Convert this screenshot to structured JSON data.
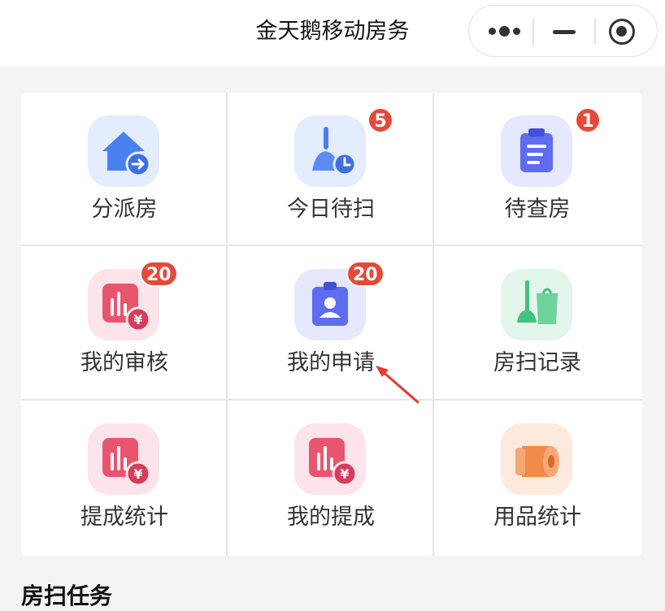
{
  "navbar": {
    "title": "金天鹅移动房务",
    "more_icon": "more-dots-icon",
    "minimize_icon": "minimize-icon",
    "close_icon": "target-close-icon"
  },
  "menu": [
    {
      "label": "分派房",
      "icon": "house-assign-icon",
      "badge": ""
    },
    {
      "label": "今日待扫",
      "icon": "broom-clock-icon",
      "badge": "5"
    },
    {
      "label": "待查房",
      "icon": "clipboard-icon",
      "badge": "1"
    },
    {
      "label": "我的审核",
      "icon": "chart-yuan-icon",
      "badge": "20"
    },
    {
      "label": "我的申请",
      "icon": "badge-id-icon",
      "badge": "20"
    },
    {
      "label": "房扫记录",
      "icon": "mop-bag-icon",
      "badge": ""
    },
    {
      "label": "提成统计",
      "icon": "chart-yuan-icon",
      "badge": ""
    },
    {
      "label": "我的提成",
      "icon": "chart-yuan-icon",
      "badge": ""
    },
    {
      "label": "用品统计",
      "icon": "tissue-roll-icon",
      "badge": ""
    }
  ],
  "section": {
    "title": "房扫任务"
  },
  "colors": {
    "badge": "#e34a3a",
    "blue_icon": "#4a7ff0",
    "pink_icon": "#e8556f",
    "green_icon": "#42c27e",
    "orange_icon": "#f28a4c",
    "annotation_arrow": "#e33a2e"
  }
}
